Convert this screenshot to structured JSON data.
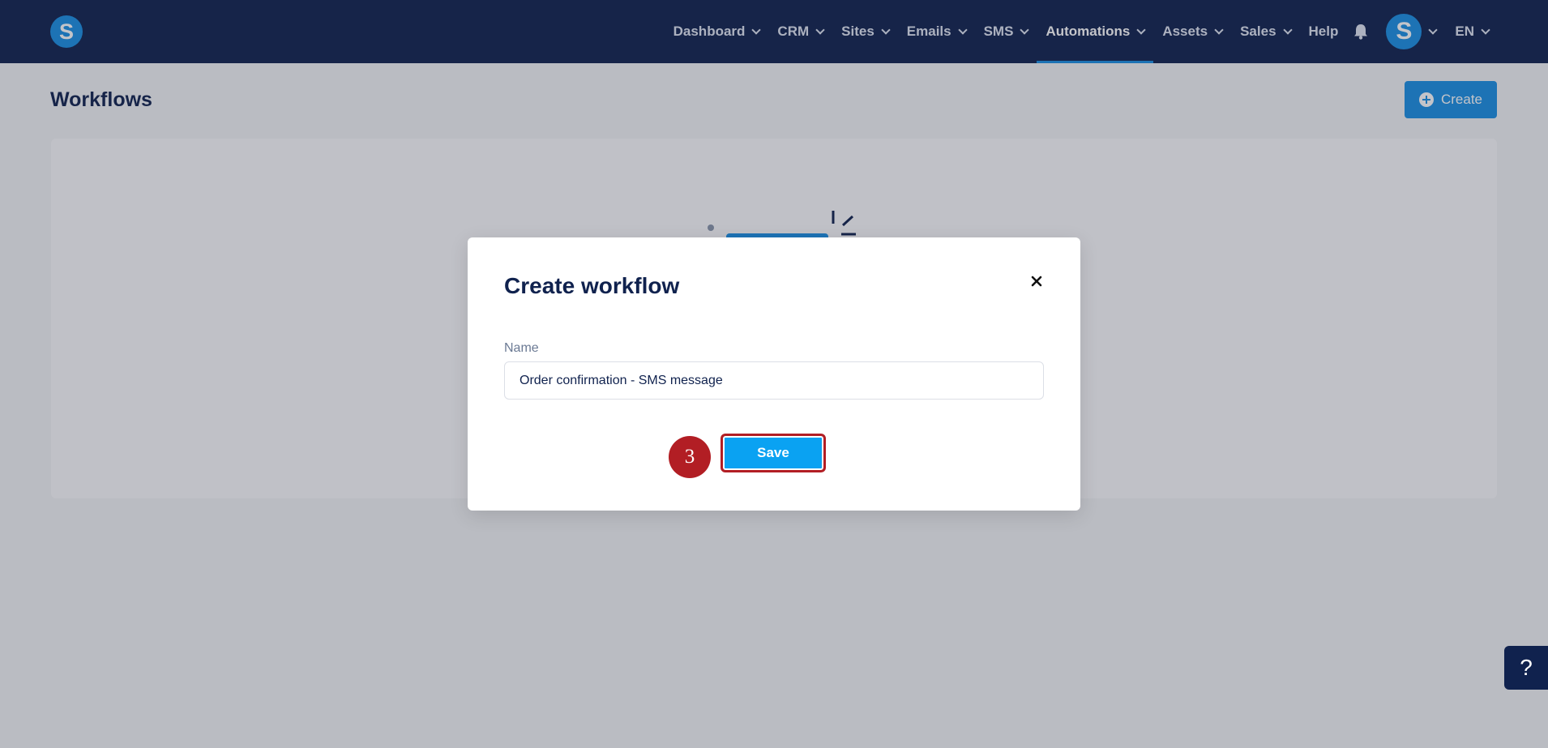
{
  "brand": {
    "logo_letter": "S"
  },
  "nav": {
    "items": [
      {
        "label": "Dashboard",
        "dropdown": true
      },
      {
        "label": "CRM",
        "dropdown": true
      },
      {
        "label": "Sites",
        "dropdown": true
      },
      {
        "label": "Emails",
        "dropdown": true
      },
      {
        "label": "SMS",
        "dropdown": true
      },
      {
        "label": "Automations",
        "dropdown": true,
        "active": true
      },
      {
        "label": "Assets",
        "dropdown": true
      },
      {
        "label": "Sales",
        "dropdown": true
      },
      {
        "label": "Help",
        "dropdown": false
      }
    ],
    "avatar_letter": "S",
    "language": "EN"
  },
  "page": {
    "title": "Workflows",
    "create_label": "Create"
  },
  "modal": {
    "title": "Create workflow",
    "name_label": "Name",
    "name_value": "Order confirmation - SMS message",
    "step_number": "3",
    "save_label": "Save"
  },
  "help": {
    "label": "?"
  },
  "colors": {
    "nav_bg": "#10224e",
    "accent": "#1a8fe3",
    "save_button": "#0aa2f2",
    "highlight": "#b21e24"
  },
  "icons": {
    "notifications": "bell-icon",
    "close": "close-icon",
    "create": "plus-circle-icon",
    "dropdown": "chevron-down-icon"
  }
}
